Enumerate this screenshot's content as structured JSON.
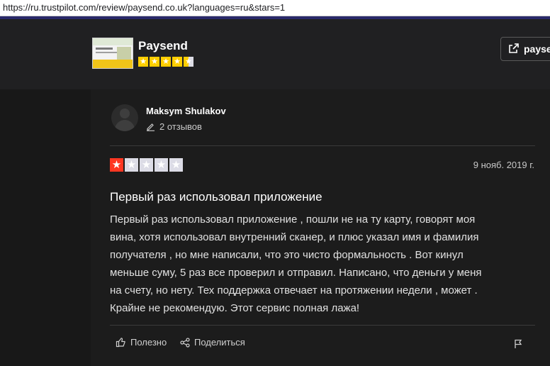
{
  "browser": {
    "url": "https://ru.trustpilot.com/review/paysend.co.uk?languages=ru&stars=1"
  },
  "company": {
    "name": "Paysend",
    "trust_rating": 4.5,
    "stars_max": 5,
    "visit_label": "paysend"
  },
  "review": {
    "author": "Maksym Shulakov",
    "reviews_count": "2 отзывов",
    "rating": 1,
    "date": "9 нояб. 2019 г.",
    "title": "Первый раз использовал приложение",
    "lines": [
      "Первый раз использовал приложение , пошли не на ту карту, говорят моя",
      "вина, хотя использовал внутренний сканер, и плюс указал имя и фамилия",
      "получателя , но мне написали, что это чисто формальность . Вот кинул",
      "меньше суму, 5 раз все проверил и отправил. Написано, что деньги у меня",
      "на счету, но нету. Тех поддержка отвечает на протяжении недели , может .",
      "Крайне не рекомендую. Этот сервис полная лажа!"
    ]
  },
  "actions": {
    "useful_label": "Полезно",
    "share_label": "Поделиться"
  },
  "colors": {
    "star_red": "#ff3722",
    "star_gold": "#ffce00",
    "star_empty": "#dcdce6"
  }
}
